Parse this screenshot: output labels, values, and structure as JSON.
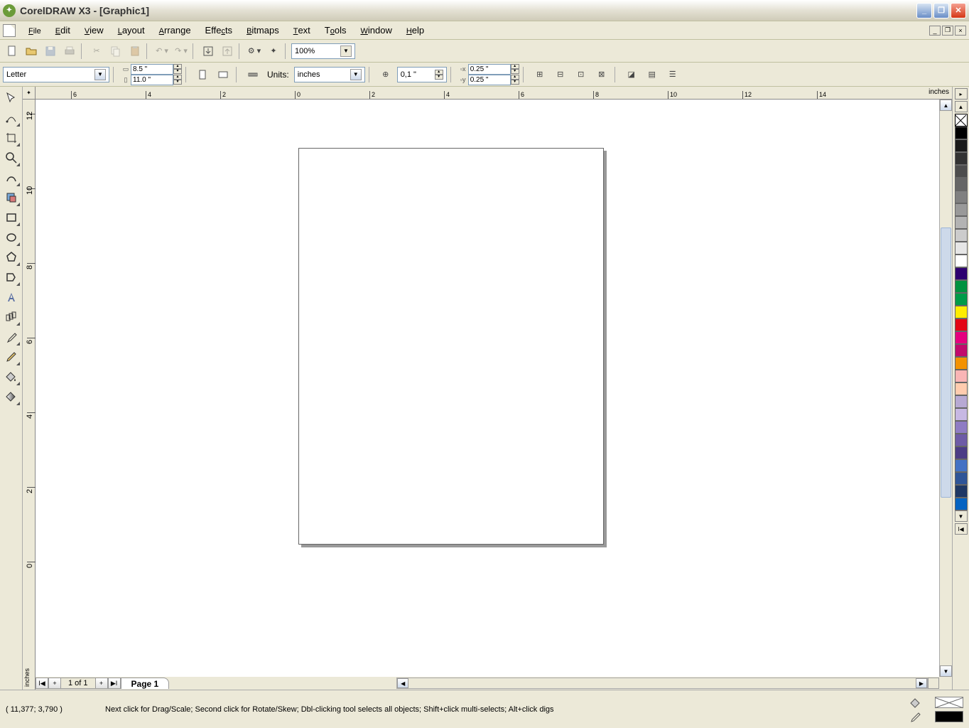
{
  "app": {
    "title": "CorelDRAW X3 - [Graphic1]"
  },
  "menu": {
    "file": "File",
    "edit": "Edit",
    "view": "View",
    "layout": "Layout",
    "arrange": "Arrange",
    "effects": "Effects",
    "bitmaps": "Bitmaps",
    "text": "Text",
    "tools": "Tools",
    "window": "Window",
    "help": "Help"
  },
  "toolbar": {
    "zoom_level": "100%"
  },
  "property_bar": {
    "paper_type": "Letter",
    "paper_width": "8.5 \"",
    "paper_height": "11.0 \"",
    "units_label": "Units:",
    "units": "inches",
    "nudge": "0,1 \"",
    "dup_x": "0.25 \"",
    "dup_y": "0.25 \""
  },
  "rulers": {
    "h_unit": "inches",
    "v_unit": "inches",
    "h_ticks": [
      "6",
      "4",
      "2",
      "0",
      "2",
      "4",
      "6",
      "8",
      "10",
      "12",
      "14"
    ],
    "v_ticks": [
      "12",
      "10",
      "8",
      "6",
      "4",
      "2",
      "0"
    ]
  },
  "page_nav": {
    "counter": "1 of 1",
    "tab": "Page 1"
  },
  "palette": {
    "colors": [
      "#000000",
      "#1a1a1a",
      "#333333",
      "#4d4d4d",
      "#666666",
      "#808080",
      "#999999",
      "#b3b3b3",
      "#cccccc",
      "#e6e6e6",
      "#ffffff",
      "#2e0070",
      "#00923f",
      "#009b48",
      "#ffed00",
      "#e30613",
      "#e5007e",
      "#c10a6c",
      "#f39200",
      "#f9b5b5",
      "#ffccae",
      "#b7a9d3",
      "#c7b8e3",
      "#8f7cc3",
      "#6e5ba6",
      "#4b3c85",
      "#4472c4",
      "#2f5597",
      "#1f3864",
      "#0563c1"
    ]
  },
  "status": {
    "coords": "( 11,377; 3,790 )",
    "hint": "Next click for Drag/Scale; Second click for Rotate/Skew; Dbl-clicking tool selects all objects; Shift+click multi-selects; Alt+click digs"
  }
}
